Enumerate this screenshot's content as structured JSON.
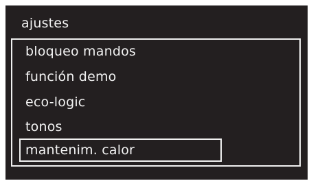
{
  "screen": {
    "title": "ajustes",
    "items": [
      {
        "label": "bloqueo mandos",
        "selected": false
      },
      {
        "label": "función demo",
        "selected": false
      },
      {
        "label": "eco-logic",
        "selected": false
      },
      {
        "label": "tonos",
        "selected": false
      },
      {
        "label": "mantenim. calor",
        "selected": true
      }
    ]
  },
  "colors": {
    "background": "#231f20",
    "text": "#f2f2f2",
    "border": "#f0f0f0"
  }
}
